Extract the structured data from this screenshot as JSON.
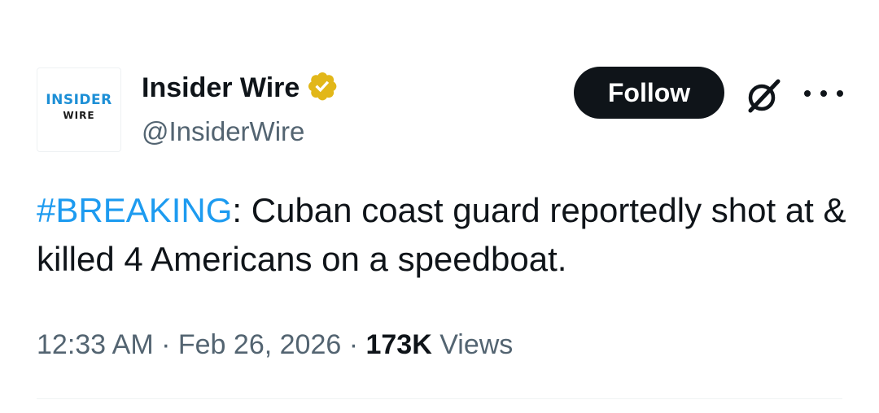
{
  "author": {
    "avatar": {
      "logo_top": "INSIDER",
      "logo_bottom": "WIRE"
    },
    "display_name": "Insider Wire",
    "handle": "@InsiderWire",
    "verified_icon": "verified-badge-gold"
  },
  "actions": {
    "follow_label": "Follow",
    "grok_icon": "grok-icon",
    "more_icon": "more-horizontal-icon"
  },
  "tweet": {
    "hashtag": "#BREAKING",
    "text": ": Cuban coast guard reportedly shot at & killed 4 Americans on a speedboat."
  },
  "meta": {
    "time": "12:33 AM",
    "separator": " · ",
    "date": "Feb 26, 2026",
    "views_count": "173K",
    "views_label": " Views"
  },
  "colors": {
    "link": "#1d9bf0",
    "text_primary": "#0f1419",
    "text_secondary": "#536471",
    "verified_gold": "#e2b719",
    "logo_blue": "#1d8fd6"
  }
}
